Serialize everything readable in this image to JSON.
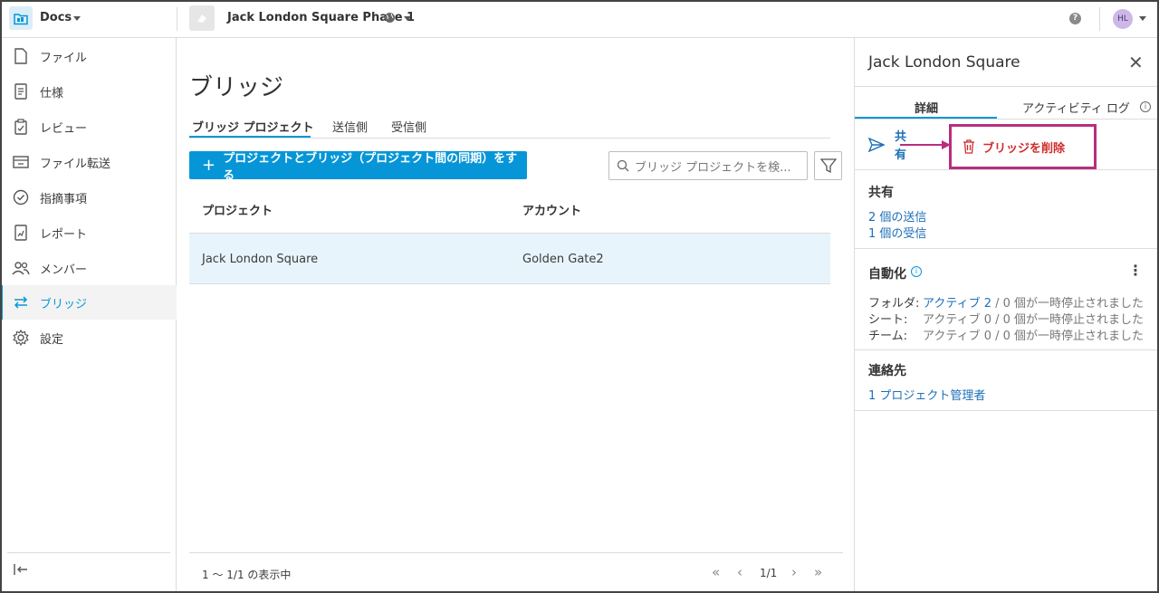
{
  "app": {
    "name": "Docs"
  },
  "project": {
    "name": "Jack London Square Phase 1"
  },
  "user": {
    "initials": "HL"
  },
  "sidebar": {
    "items": [
      {
        "label": "ファイル",
        "icon": "file-icon"
      },
      {
        "label": "仕様",
        "icon": "spec-icon"
      },
      {
        "label": "レビュー",
        "icon": "review-icon"
      },
      {
        "label": "ファイル転送",
        "icon": "transfer-icon"
      },
      {
        "label": "指摘事項",
        "icon": "issues-icon"
      },
      {
        "label": "レポート",
        "icon": "report-icon"
      },
      {
        "label": "メンバー",
        "icon": "members-icon"
      },
      {
        "label": "ブリッジ",
        "icon": "bridge-icon",
        "active": true
      },
      {
        "label": "設定",
        "icon": "settings-icon"
      }
    ]
  },
  "main": {
    "title": "ブリッジ",
    "tabs": [
      "ブリッジ プロジェクト",
      "送信側",
      "受信側"
    ],
    "primary_button": "プロジェクトとブリッジ（プロジェクト間の同期）をする",
    "search_placeholder": "ブリッジ プロジェクトを検...",
    "columns": [
      "プロジェクト",
      "アカウント"
    ],
    "rows": [
      {
        "project": "Jack London Square",
        "account": "Golden Gate2"
      }
    ],
    "footer": "1 ～ 1/1 の表示中",
    "page": "1/1"
  },
  "panel": {
    "title": "Jack London Square",
    "tabs": [
      "詳細",
      "アクティビティ ログ"
    ],
    "share_label": "共有",
    "delete_label": "ブリッジを削除",
    "sharing": {
      "title": "共有",
      "sent": "2 個の送信",
      "received": "1 個の受信"
    },
    "automation": {
      "title": "自動化",
      "rows": [
        {
          "key": "フォルダ:",
          "active": "アクティブ 2",
          "sep": " / ",
          "paused": "0 個が一時停止されました",
          "highlight": true
        },
        {
          "key": "シート:",
          "active": "アクティブ 0",
          "sep": " / ",
          "paused": "0 個が一時停止されました",
          "highlight": false
        },
        {
          "key": "チーム:",
          "active": "アクティブ 0",
          "sep": " / ",
          "paused": "0 個が一時停止されました",
          "highlight": false
        }
      ]
    },
    "contacts": {
      "title": "連絡先",
      "admin": "1 プロジェクト管理者"
    }
  },
  "colors": {
    "accent": "#0696d7",
    "highlight_box": "#b72e7e",
    "delete": "#d02c2c",
    "link": "#1d6fb8"
  }
}
